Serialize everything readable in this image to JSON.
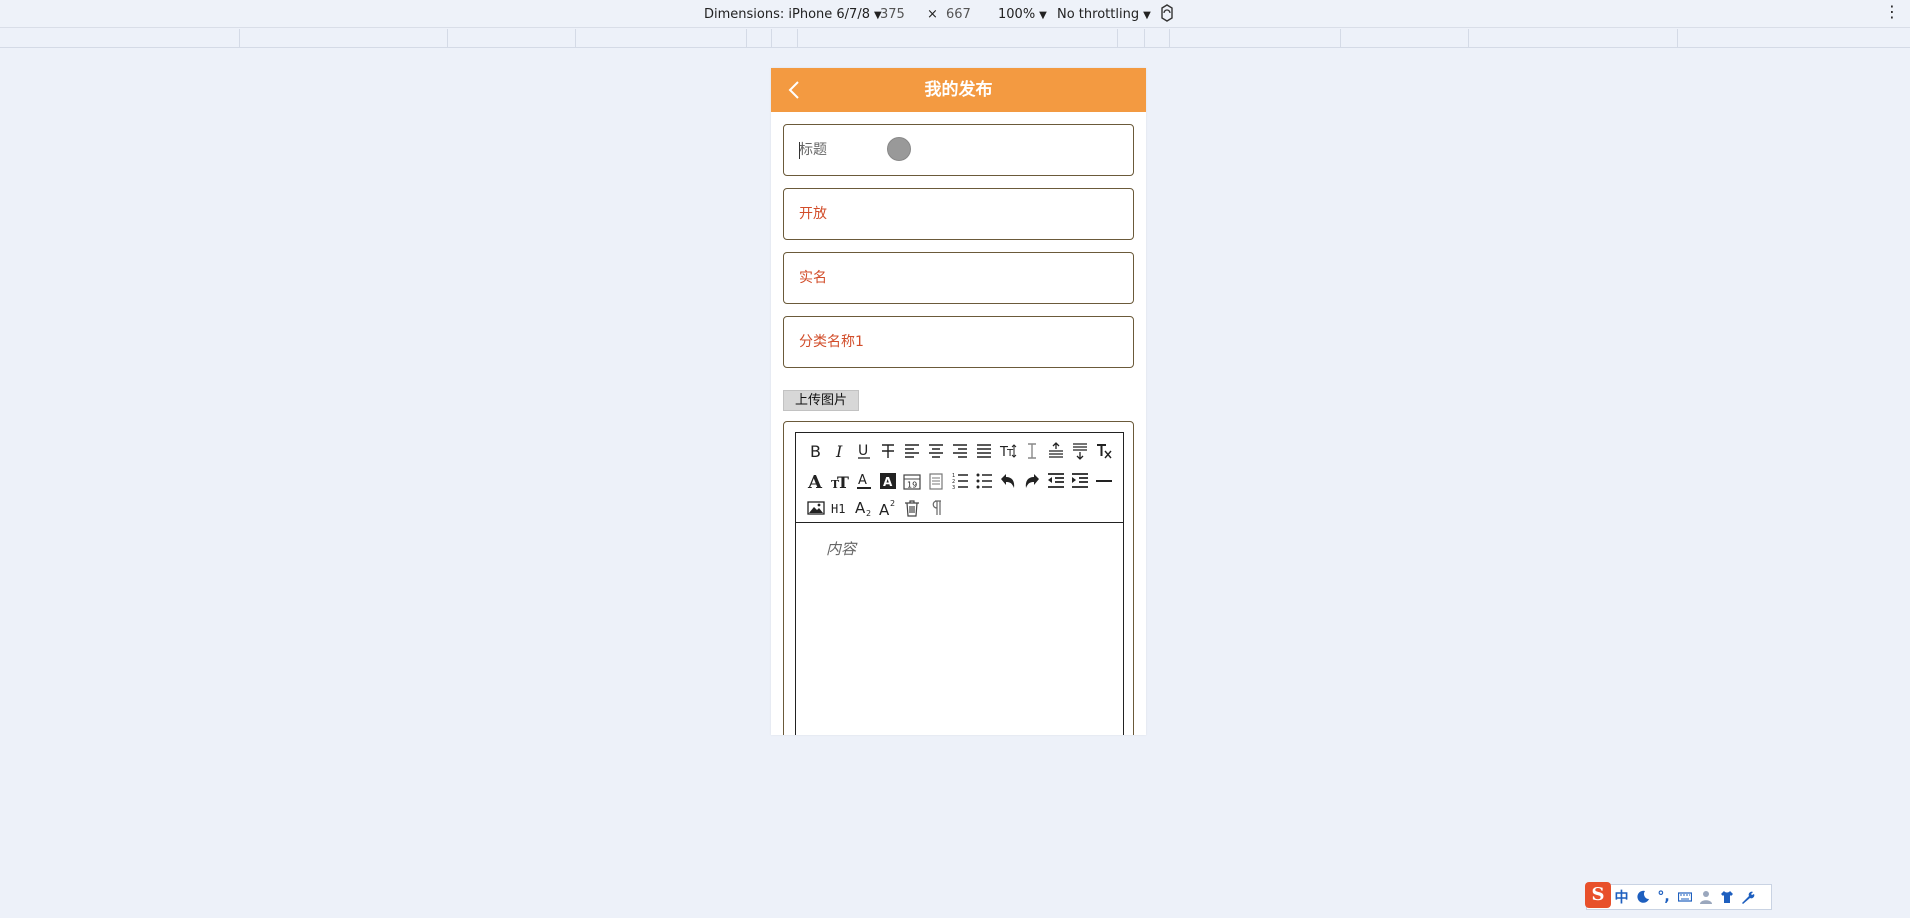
{
  "devtools": {
    "device_label": "Dimensions: iPhone 6/7/8",
    "width": "375",
    "times": "×",
    "height": "667",
    "zoom": "100%",
    "throttling": "No throttling",
    "menu_glyph": "⋮"
  },
  "header": {
    "title": "我的发布"
  },
  "form": {
    "title_placeholder": "标题",
    "open_value": "开放",
    "realname_value": "实名",
    "category_value": "分类名称1",
    "upload_label": "上传图片",
    "content_placeholder": "内容"
  },
  "editor_toolbar": {
    "row1": [
      "bold-icon",
      "italic-icon",
      "underline-icon",
      "strikethrough-icon",
      "align-left-icon",
      "align-center-icon",
      "align-right-icon",
      "align-justify-icon",
      "font-size-icon",
      "line-height-icon",
      "paragraph-spacing-top-icon",
      "paragraph-spacing-bottom-icon",
      "clear-format-icon"
    ],
    "row2": [
      "font-family-icon",
      "font-size-2-icon",
      "font-color-icon",
      "background-color-icon",
      "insert-date-icon",
      "insert-time-icon",
      "ordered-list-icon",
      "unordered-list-icon",
      "undo-icon",
      "redo-icon",
      "outdent-icon",
      "indent-icon",
      "horizontal-rule-icon"
    ],
    "row3": [
      "image-icon",
      "heading-icon",
      "subscript-icon",
      "superscript-icon",
      "delete-icon",
      "paragraph-mark-icon"
    ],
    "labels": {
      "bold": "B",
      "italic": "I",
      "underline": "U",
      "heading": "H1",
      "date": "19"
    }
  },
  "ime": {
    "logo": "S",
    "lang": "中",
    "punct": "°,"
  },
  "colors": {
    "header": "#f39a41",
    "value_text": "#d24d2a",
    "field_border": "#6b5a3a",
    "page_bg": "#edf1f9"
  }
}
